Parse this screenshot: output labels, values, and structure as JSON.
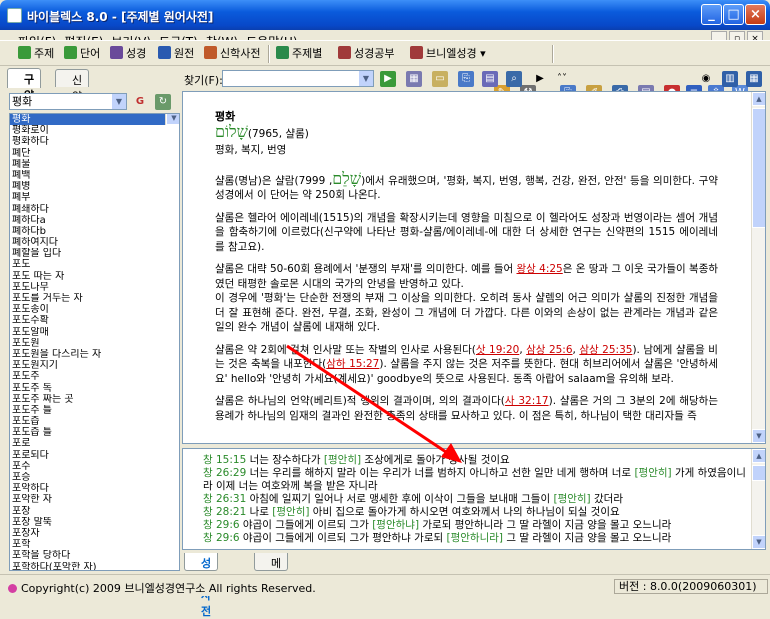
{
  "window": {
    "title": "바이블렉스 8.0 - [주제별 원어사전]"
  },
  "menu": [
    "파일(F)",
    "편집(E)",
    "보기(V)",
    "도구(T)",
    "창(W)",
    "도움말(H)"
  ],
  "toolbar": {
    "topic": "주제",
    "word": "단어",
    "bible": "성경",
    "original": "원전",
    "theology_dict": "신학사전",
    "topic_index": "주제별",
    "bible_study": "성경공부",
    "bnv_bible": "브니엘성경"
  },
  "left_panel": {
    "tabs": [
      "구약",
      "신약"
    ],
    "search_value": "평화",
    "words": [
      "평화",
      "평화로이",
      "평화하다",
      "폐단",
      "폐물",
      "폐백",
      "폐병",
      "폐부",
      "폐쇄하다",
      "폐하다a",
      "폐하다b",
      "폐하여지다",
      "폐할을 입다",
      "포도",
      "포도 따는 자",
      "포도나무",
      "포도를 거두는 자",
      "포도송이",
      "포도수확",
      "포도알매",
      "포도원",
      "포도원을 다스리는 자",
      "포도원지기",
      "포도주",
      "포도주 독",
      "포도주 짜는 곳",
      "포도주 틀",
      "포도즙",
      "포도즙 틀",
      "포로",
      "포로되다",
      "포수",
      "포승",
      "포악하다",
      "포악한 자",
      "포장",
      "포장 말뚝",
      "포장자",
      "포학",
      "포학을 당하다",
      "포학하다(포악한 자)",
      "포학한 자(포악한 자)",
      "폭"
    ]
  },
  "find": {
    "label": "찾기(F):",
    "value": ""
  },
  "article": {
    "headword": "평화",
    "hebrew": "שָׁלוֹם",
    "number": "(7965, 샬롬)",
    "gloss": "평화, 복지, 번영",
    "p1a": "샬롬(명남)은 샬람(",
    "p1heb": "שָׁלֵם",
    "p1b": ", 7999)에서 유래했으며, '평화, 복지, 번영, 행복, 건강, 완전, 안전' 등을 의미한다. 구약성경에서 이 단어는 약 250회 나온다.",
    "p2": "샬롬은 헬라어 에이레네(1515)의 개념을 확장시키는데 영향을 미침으로 이 헬라어도 성장과 번영이라는 셈어 개념을 함축하기에 이르렀다(신구약에 나타난 평화-샬롬/에이레네-에 대한 더 상세한 연구는 신약편의 1515 에이레네를 참고요).",
    "p3a": "샬롬은 대략 50-60회 용례에서 '분쟁의 부재'를 의미한다. 예를 들어 ",
    "p3ref": "왕상 4:25",
    "p3b": "은 온 땅과 그 이웃 국가들이 복종하였던 태평한 솔로몬 시대의 국가의 안녕을 반영하고 있다.",
    "p3c": "이 경우에 '평화'는 단순한 전쟁의 부재 그 이상을 의미한다. 오히려 동사 샬렘의 어근 의미가 샬롬의 진정한 개념을 더 잘 표현해 준다. 완전, 무결, 조화, 완성이 그 개념에 더 가깝다. 다른 이와의 손상이 없는 관계라는 개념과 같은 일의 완수 개념이 샬롬에 내재해 있다.",
    "p4a": "샬롬은 약 2회에 걸쳐 인사말 또는 작별의 인사로 사용된다(",
    "p4r1": "삿 19:20",
    "p4r2": "삼상 25:6",
    "p4r3": "삼상 25:35",
    "p4b": "). 남에게 샬롬을 비는 것은 축복을 내포한다(",
    "p4r4": "삼하 15:27",
    "p4c": "). 샬롬을 주지 않는 것은 저주를 뜻한다. 현대 히브리어에서 샬롬은 '안녕하세요' hello와 '안녕히 가세요(계세요)' goodbye의 뜻으로 사용된다. 동족 아랍어 salaam을 유의해 보라.",
    "p5a": "샬롬은 하나님의 언약(베리트)적 행위의 결과이며, 의의 결과이다(",
    "p5r": "사 32:17",
    "p5b": "). 샬롬은 거의 그 3분의 2에 해당하는 용례가 하나님의 임재의 결과인 완전한 충족의 상태를 묘사하고 있다. 이 점은 특히, 하나님이 택한 대리자들 즉"
  },
  "verses": [
    {
      "ref": "창 15:15",
      "a": "너는 장수하다가 ",
      "tag": "[평안히]",
      "b": " 조상에게로 돌아가 장사될 것이요"
    },
    {
      "ref": "창 26:29",
      "a": "너는 우리를 해하지 말라 이는 우리가 너를 범하지 아니하고 선한 일만 네게 행하며 너로 ",
      "tag": "[평안히]",
      "b": " 가게 하였음이니라 이제 너는 여호와께 복을 받은 자니라"
    },
    {
      "ref": "창 26:31",
      "a": "아침에 일찌기 일어나 서로 맹세한 후에 이삭이 그들을 보내매 그들이 ",
      "tag": "[평안히]",
      "b": " 갔더라"
    },
    {
      "ref": "창 28:21",
      "a": "나로 ",
      "tag": "[평안히]",
      "b": " 아비 집으로 돌아가게 하시오면 여호와께서 나의 하나님이 되실 것이요"
    },
    {
      "ref": "창 29:6",
      "a": "야곱이 그들에게 이르되 그가 ",
      "tag": "[평안하냐]",
      "b": " 가로되 평안하니라 그 딸 라헬이 지금 양을 몰고 오느니라"
    },
    {
      "ref": "창 29:6",
      "a": "야곱이 그들에게 이르되 그가 평안하냐 가로되 ",
      "tag": "[평안하니라]",
      "b": " 그 딸 라헬이 지금 양을 몰고 오느니라"
    }
  ],
  "bottom_tabs": [
    "성구사전",
    "메모"
  ],
  "status": {
    "copyright": "Copyright(c) 2009 브니엘성경연구소 All rights Reserved.",
    "version": "버전 : 8.0.0(2009060301)"
  }
}
